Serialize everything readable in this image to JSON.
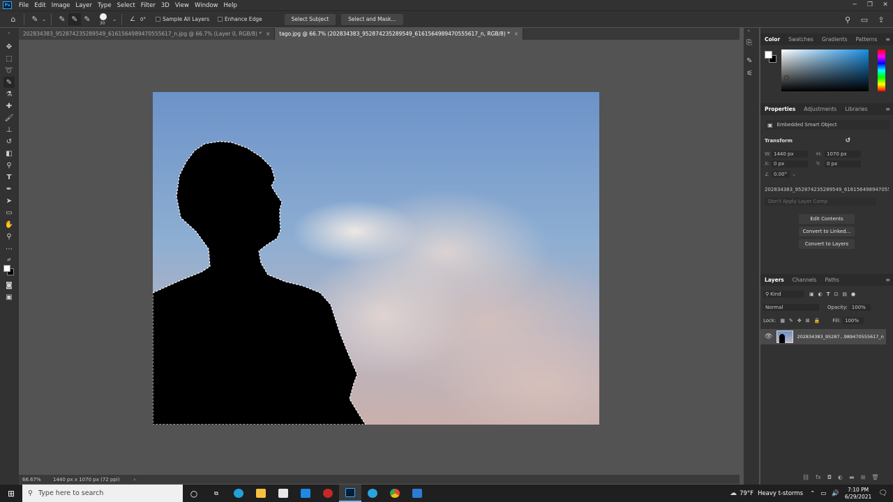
{
  "menu": [
    "File",
    "Edit",
    "Image",
    "Layer",
    "Type",
    "Select",
    "Filter",
    "3D",
    "View",
    "Window",
    "Help"
  ],
  "app_logo": "Ps",
  "options": {
    "brush_size": "30",
    "angle": "0°",
    "sample_all_layers": "Sample All Layers",
    "enhance_edge": "Enhance Edge",
    "select_subject": "Select Subject",
    "select_and_mask": "Select and Mask..."
  },
  "tabs": [
    {
      "label": "202834383_952874235289549_6161564989470555617_n.jpg @ 66.7% (Layer 0, RGB/8) *",
      "active": false
    },
    {
      "label": "tago.jpg @ 66.7% (202834383_952874235289549_6161564989470555617_n, RGB/8) *",
      "active": true
    }
  ],
  "status": {
    "zoom": "66.67%",
    "doc_info": "1440 px x 1070 px (72 ppi)",
    "arrow": "›"
  },
  "color_panel": {
    "tabs": [
      "Color",
      "Swatches",
      "Gradients",
      "Patterns"
    ]
  },
  "properties": {
    "tabs": [
      "Properties",
      "Adjustments",
      "Libraries"
    ],
    "object_type": "Embedded Smart Object",
    "section": "Transform",
    "w_label": "W:",
    "w": "1440 px",
    "h_label": "H:",
    "h": "1070 px",
    "x_label": "X:",
    "x": "0 px",
    "y_label": "Y:",
    "y": "0 px",
    "angle": "0.00°",
    "filename": "202834383_952874235289549_6161564989470555...",
    "layer_comp": "Don't Apply Layer Comp",
    "buttons": [
      "Edit Contents",
      "Convert to Linked...",
      "Convert to Layers"
    ]
  },
  "layers": {
    "tabs": [
      "Layers",
      "Channels",
      "Paths"
    ],
    "kind": "Kind",
    "blend_mode": "Normal",
    "opacity_label": "Opacity:",
    "opacity": "100%",
    "lock_label": "Lock:",
    "fill_label": "Fill:",
    "fill": "100%",
    "layer_name": "202834383_95287...989470555617_n"
  },
  "taskbar": {
    "search_placeholder": "Type here to search",
    "weather_temp": "79°F",
    "weather_desc": "Heavy t-storms",
    "time": "7:10 PM",
    "date": "6/29/2021"
  },
  "colors": {
    "panel_bg": "#323232",
    "canvas_bg": "#535353",
    "ps_blue": "#31a8ff"
  }
}
